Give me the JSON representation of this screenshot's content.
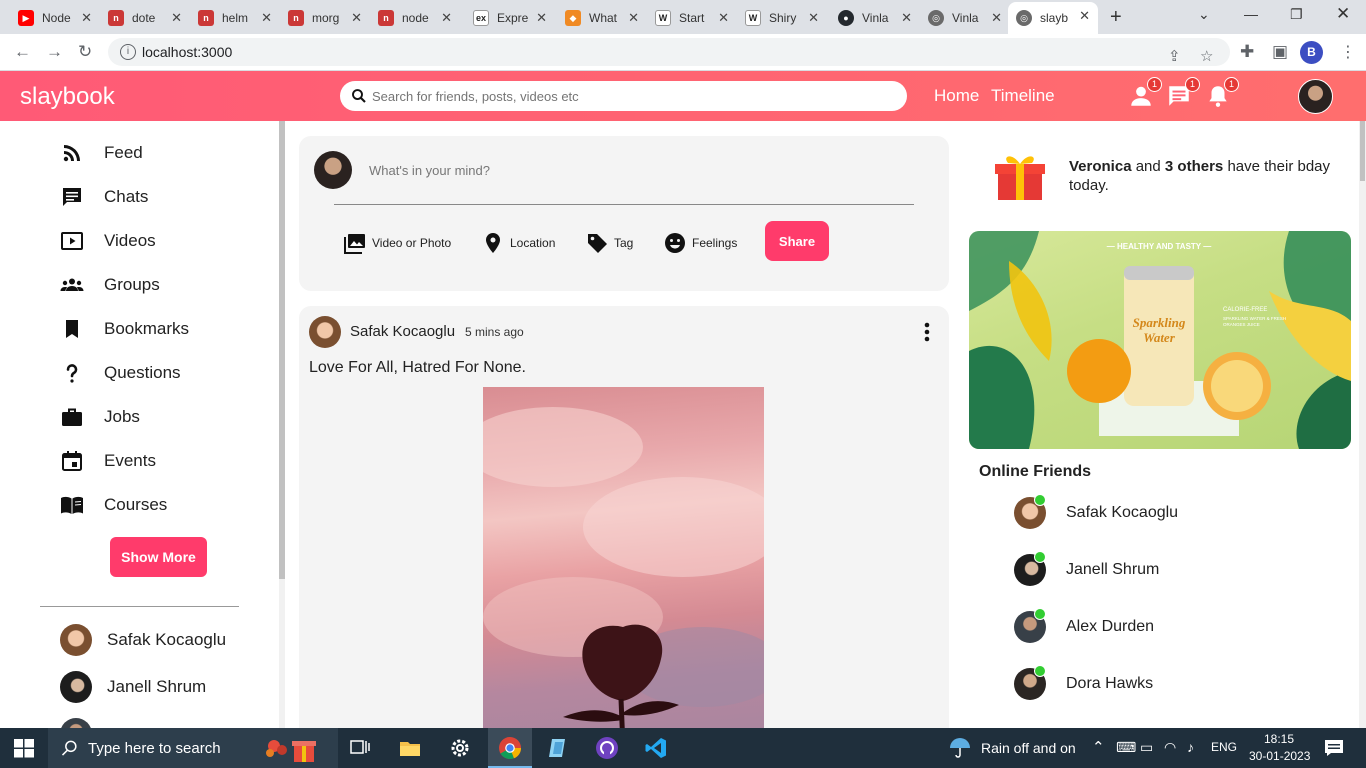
{
  "browser": {
    "tabs": [
      {
        "title": "Node",
        "color": "#ff0000",
        "glyph": "▶"
      },
      {
        "title": "dote",
        "color": "#cb3837",
        "glyph": "n"
      },
      {
        "title": "helm",
        "color": "#cb3837",
        "glyph": "n"
      },
      {
        "title": "morg",
        "color": "#cb3837",
        "glyph": "n"
      },
      {
        "title": "node",
        "color": "#cb3837",
        "glyph": "n"
      },
      {
        "title": "Expre",
        "color": "#ffffff",
        "glyph": "ex"
      },
      {
        "title": "What",
        "color": "#f08a24",
        "glyph": "◆"
      },
      {
        "title": "Start",
        "color": "#ffffff",
        "glyph": "W"
      },
      {
        "title": "Shiry",
        "color": "#ffffff",
        "glyph": "W"
      },
      {
        "title": "Vinla",
        "color": "#24292e",
        "glyph": "●"
      },
      {
        "title": "Vinla",
        "color": "#6a6a6a",
        "glyph": "◎"
      },
      {
        "title": "slayb",
        "color": "#6a6a6a",
        "glyph": "◎",
        "active": true
      }
    ],
    "url": "localhost:3000",
    "profile_initial": "B"
  },
  "app": {
    "logo": "slaybook",
    "search_placeholder": "Search for friends, posts, videos etc",
    "nav_links": [
      "Home",
      "Timeline"
    ],
    "badges": {
      "friend_requests": "1",
      "messages": "1",
      "notifications": "1"
    },
    "accent": "#ff3b6b"
  },
  "sidebar": {
    "items": [
      {
        "label": "Feed",
        "icon": "rss-icon"
      },
      {
        "label": "Chats",
        "icon": "chat-icon"
      },
      {
        "label": "Videos",
        "icon": "video-icon"
      },
      {
        "label": "Groups",
        "icon": "groups-icon"
      },
      {
        "label": "Bookmarks",
        "icon": "bookmark-icon"
      },
      {
        "label": "Questions",
        "icon": "question-icon"
      },
      {
        "label": "Jobs",
        "icon": "briefcase-icon"
      },
      {
        "label": "Events",
        "icon": "calendar-icon"
      },
      {
        "label": "Courses",
        "icon": "book-icon"
      }
    ],
    "show_more": "Show More",
    "friends": [
      "Safak Kocaoglu",
      "Janell Shrum"
    ]
  },
  "share": {
    "placeholder": "What's in your mind?",
    "options": [
      "Video or Photo",
      "Location",
      "Tag",
      "Feelings"
    ],
    "button": "Share"
  },
  "post": {
    "author": "Safak Kocaoglu",
    "time": "5 mins ago",
    "text": "Love For All, Hatred For None."
  },
  "rightbar": {
    "birthday": {
      "name": "Veronica",
      "mid": " and ",
      "others": "3 others",
      "suffix": " have their bday today."
    },
    "ad": {
      "tag": "— HEALTHY AND TASTY —",
      "can_line1": "Sparkling",
      "can_line2": "Water",
      "side1": "CALORIE-FREE",
      "side2": "SPARKLING WATER & FRESH",
      "side3": "ORANGES JUICE"
    },
    "online_title": "Online Friends",
    "online_friends": [
      "Safak Kocaoglu",
      "Janell Shrum",
      "Alex Durden",
      "Dora Hawks"
    ]
  },
  "taskbar": {
    "search_placeholder": "Type here to search",
    "weather": "Rain off and on",
    "lang": "ENG",
    "time": "18:15",
    "date": "30-01-2023"
  }
}
